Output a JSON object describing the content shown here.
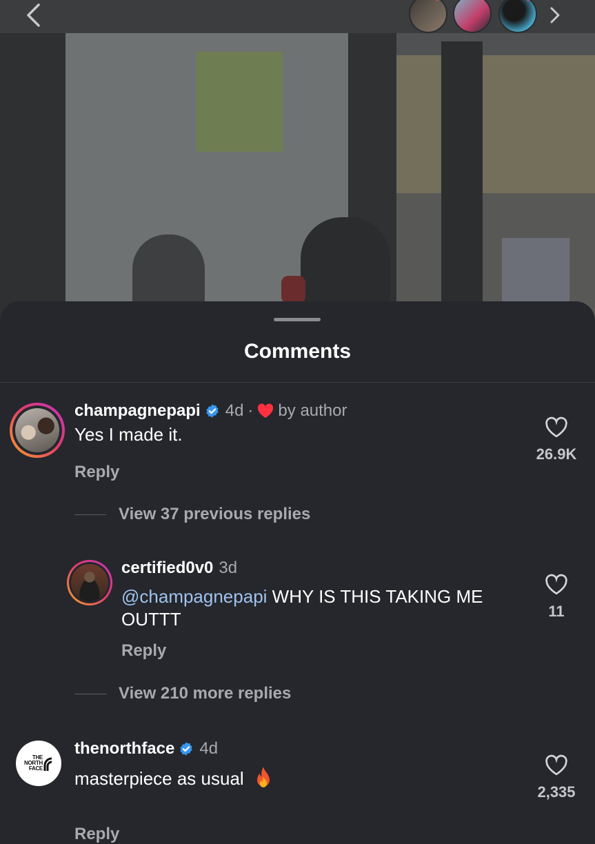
{
  "story_viewers": {
    "avatars": [
      "avatar-1",
      "avatar-2",
      "avatar-3"
    ],
    "heart_color": "#e0486f"
  },
  "sheet": {
    "title": "Comments"
  },
  "comments": [
    {
      "username": "champagnepapi",
      "verified": true,
      "time": "4d",
      "separator": "·",
      "liked_by_author": "by author",
      "text": "Yes I made it.",
      "reply_label": "Reply",
      "likes": "26.9K",
      "view_replies": "View 37 previous replies"
    },
    {
      "username": "certified0v0",
      "verified": false,
      "time": "3d",
      "mention": "@champagnepapi",
      "text_line1": " WHY IS THIS TAKING ME",
      "text_line2": "OUTTT",
      "reply_label": "Reply",
      "likes": "11",
      "view_replies": "View 210 more replies"
    },
    {
      "username": "thenorthface",
      "verified": true,
      "time": "4d",
      "text": "masterpiece as usual",
      "reply_label": "Reply",
      "likes": "2,335",
      "avatar_logo": [
        "THE",
        "NORTH",
        "FACE"
      ]
    }
  ],
  "colors": {
    "accent_blue": "#3897f0",
    "heart_red": "#ff3040",
    "mention": "#9fc3ee"
  }
}
